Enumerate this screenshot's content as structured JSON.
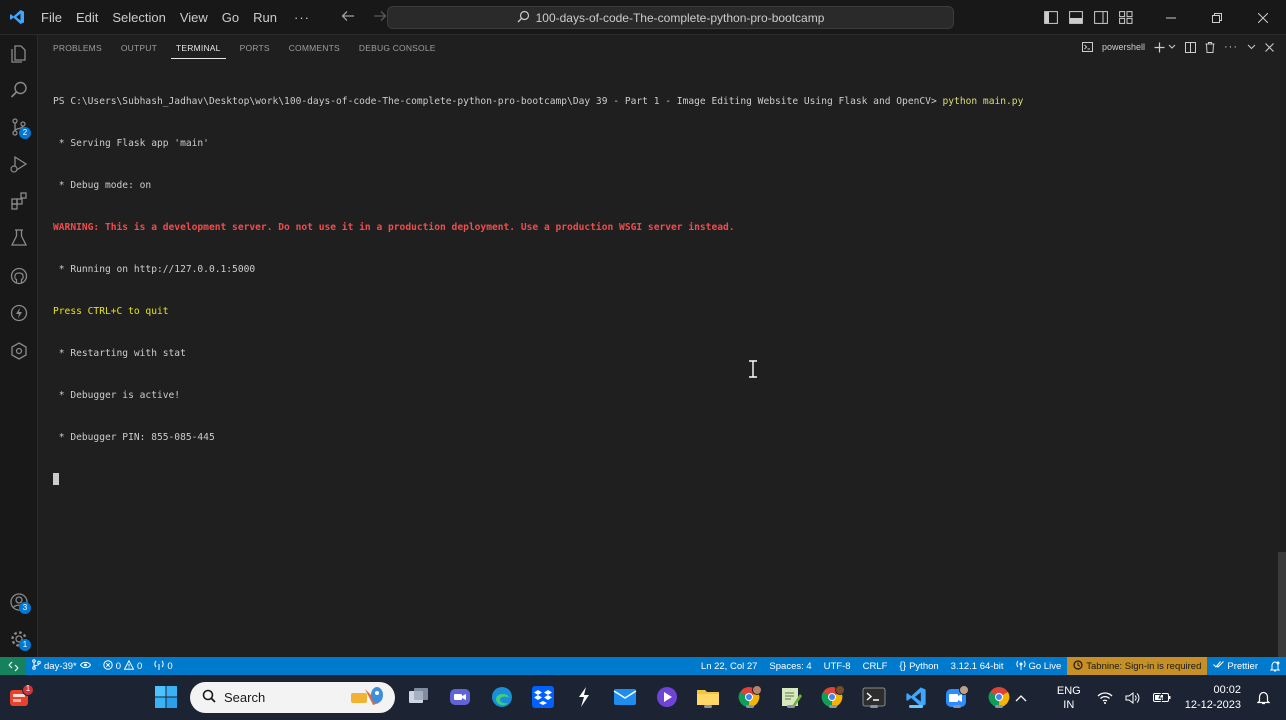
{
  "titlebar": {
    "menu": [
      "File",
      "Edit",
      "Selection",
      "View",
      "Go",
      "Run"
    ],
    "more": "···",
    "command_center": "100-days-of-code-The-complete-python-pro-bootcamp"
  },
  "activitybar": {
    "badges": {
      "source_control": "2",
      "accounts": "3",
      "manage": "1"
    }
  },
  "panel": {
    "tabs": [
      {
        "label": "PROBLEMS",
        "active": false
      },
      {
        "label": "OUTPUT",
        "active": false
      },
      {
        "label": "TERMINAL",
        "active": true
      },
      {
        "label": "PORTS",
        "active": false
      },
      {
        "label": "COMMENTS",
        "active": false
      },
      {
        "label": "DEBUG CONSOLE",
        "active": false
      }
    ],
    "shell_label": "powershell"
  },
  "terminal": {
    "prompt": "PS C:\\Users\\Subhash_Jadhav\\Desktop\\work\\100-days-of-code-The-complete-python-pro-bootcamp\\Day 39 - Part 1 - Image Editing Website Using Flask and OpenCV> ",
    "command": "python main.py",
    "lines": [
      " * Serving Flask app 'main'",
      " * Debug mode: on"
    ],
    "warning": "WARNING: This is a development server. Do not use it in a production deployment. Use a production WSGI server instead.",
    "running": " * Running on http://127.0.0.1:5000",
    "quit": "Press CTRL+C to quit",
    "lines_after": [
      " * Restarting with stat",
      " * Debugger is active!",
      " * Debugger PIN: 855-085-445"
    ]
  },
  "statusbar": {
    "branch": "day-39*",
    "errors": "0",
    "warnings": "0",
    "ports": "0",
    "position": "Ln 22, Col 27",
    "spaces": "Spaces: 4",
    "encoding": "UTF-8",
    "eol": "CRLF",
    "language": "Python",
    "interpreter": "3.12.1 64-bit",
    "golive": "Go Live",
    "tabnine": "Tabnine: Sign-in is required",
    "prettier": "Prettier"
  },
  "taskbar": {
    "search_label": "Search",
    "widget_badge": "1",
    "lang_top": "ENG",
    "lang_bottom": "IN",
    "time": "00:02",
    "date": "12-12-2023"
  },
  "colors": {
    "accent": "#007acc",
    "remote": "#16825d",
    "warning_text": "#f14c4c",
    "tabnine": "#c69026"
  }
}
